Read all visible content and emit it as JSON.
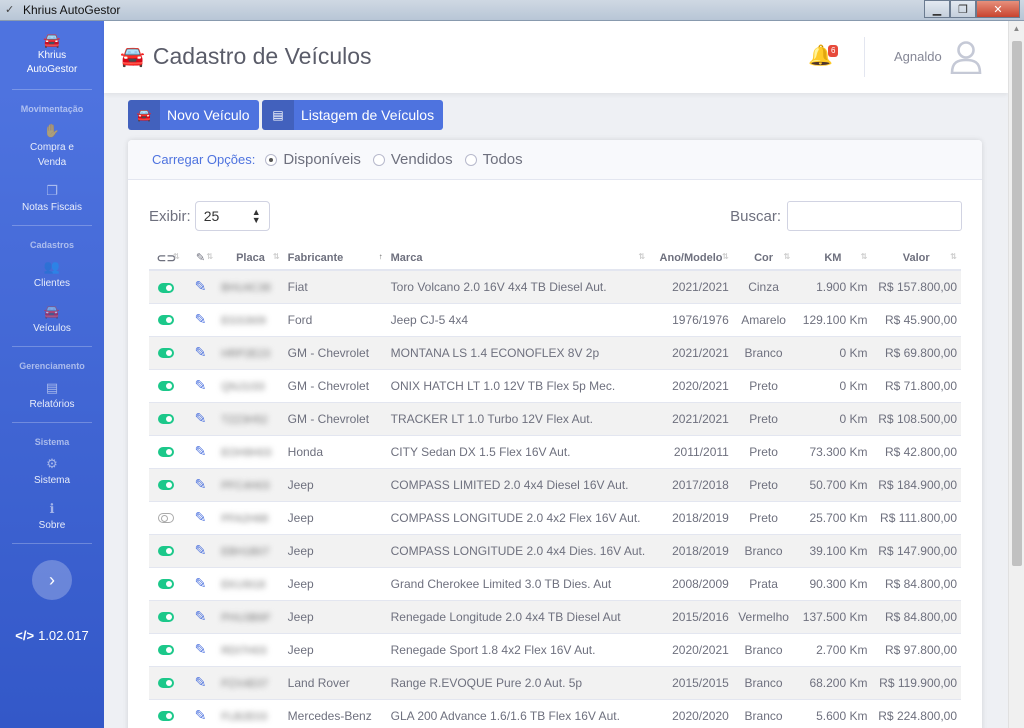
{
  "window": {
    "title": "Khrius AutoGestor"
  },
  "sidebar": {
    "brand_line1": "Khrius",
    "brand_line2": "AutoGestor",
    "sections": [
      {
        "heading": "Movimentação",
        "items": [
          {
            "label_line1": "Compra e",
            "label_line2": "Venda",
            "icon": "hand-holding-icon"
          },
          {
            "label_line1": "Notas Fiscais",
            "label_line2": "",
            "icon": "copy-icon"
          }
        ]
      },
      {
        "heading": "Cadastros",
        "items": [
          {
            "label_line1": "Clientes",
            "label_line2": "",
            "icon": "users-icon"
          },
          {
            "label_line1": "Veículos",
            "label_line2": "",
            "icon": "car-icon"
          }
        ]
      },
      {
        "heading": "Gerenciamento",
        "items": [
          {
            "label_line1": "Relatórios",
            "label_line2": "",
            "icon": "file-icon"
          }
        ]
      },
      {
        "heading": "Sistema",
        "items": [
          {
            "label_line1": "Sistema",
            "label_line2": "",
            "icon": "gear-icon"
          },
          {
            "label_line1": "Sobre",
            "label_line2": "",
            "icon": "info-icon"
          }
        ]
      }
    ],
    "version": "1.02.017"
  },
  "topbar": {
    "title": "Cadastro de Veículos",
    "notifications": "6",
    "user": "Agnaldo"
  },
  "actions": {
    "new_vehicle": "Novo Veículo",
    "vehicle_list": "Listagem de Veículos"
  },
  "filter": {
    "label": "Carregar Opções:",
    "options": [
      "Disponíveis",
      "Vendidos",
      "Todos"
    ],
    "selected": "Disponíveis"
  },
  "table_controls": {
    "show_label": "Exibir:",
    "page_size": "25",
    "search_label": "Buscar:",
    "search_value": ""
  },
  "table": {
    "headers": [
      "Placa",
      "Fabricante",
      "Marca",
      "Ano/Modelo",
      "Cor",
      "KM",
      "Valor"
    ],
    "rows": [
      {
        "active": true,
        "placa": "BHU4C38",
        "fabricante": "Fiat",
        "marca": "Toro Volcano 2.0 16V 4x4 TB Diesel Aut.",
        "ano": "2021/2021",
        "cor": "Cinza",
        "km": "1.900 Km",
        "valor": "R$ 157.800,00"
      },
      {
        "active": true,
        "placa": "EGS3I09",
        "fabricante": "Ford",
        "marca": "Jeep CJ-5 4x4",
        "ano": "1976/1976",
        "cor": "Amarelo",
        "km": "129.100 Km",
        "valor": "R$ 45.900,00"
      },
      {
        "active": true,
        "placa": "HRP2E23",
        "fabricante": "GM - Chevrolet",
        "marca": "MONTANA LS 1.4 ECONOFLEX 8V 2p",
        "ano": "2021/2021",
        "cor": "Branco",
        "km": "0 Km",
        "valor": "R$ 69.800,00"
      },
      {
        "active": true,
        "placa": "QNJ1I33",
        "fabricante": "GM - Chevrolet",
        "marca": "ONIX HATCH LT 1.0 12V TB Flex 5p Mec.",
        "ano": "2020/2021",
        "cor": "Preto",
        "km": "0 Km",
        "valor": "R$ 71.800,00"
      },
      {
        "active": true,
        "placa": "TZZ3H52",
        "fabricante": "GM - Chevrolet",
        "marca": "TRACKER LT 1.0 Turbo 12V Flex Aut.",
        "ano": "2021/2021",
        "cor": "Preto",
        "km": "0 Km",
        "valor": "R$ 108.500,00"
      },
      {
        "active": true,
        "placa": "EOH9H03",
        "fabricante": "Honda",
        "marca": "CITY Sedan DX 1.5 Flex 16V Aut.",
        "ano": "2011/2011",
        "cor": "Preto",
        "km": "73.300 Km",
        "valor": "R$ 42.800,00"
      },
      {
        "active": true,
        "placa": "PFC4H03",
        "fabricante": "Jeep",
        "marca": "COMPASS LIMITED 2.0 4x4 Diesel 16V Aut.",
        "ano": "2017/2018",
        "cor": "Preto",
        "km": "50.700 Km",
        "valor": "R$ 184.900,00"
      },
      {
        "active": false,
        "placa": "PFA2H68",
        "fabricante": "Jeep",
        "marca": "COMPASS LONGITUDE 2.0 4x2 Flex 16V Aut.",
        "ano": "2018/2019",
        "cor": "Preto",
        "km": "25.700 Km",
        "valor": "R$ 111.800,00"
      },
      {
        "active": true,
        "placa": "EBH1B07",
        "fabricante": "Jeep",
        "marca": "COMPASS LONGITUDE 2.0 4x4 Dies. 16V Aut.",
        "ano": "2018/2019",
        "cor": "Branco",
        "km": "39.100 Km",
        "valor": "R$ 147.900,00"
      },
      {
        "active": true,
        "placa": "EKU9I18",
        "fabricante": "Jeep",
        "marca": "Grand Cherokee Limited 3.0 TB Dies. Aut",
        "ano": "2008/2009",
        "cor": "Prata",
        "km": "90.300 Km",
        "valor": "R$ 84.800,00"
      },
      {
        "active": true,
        "placa": "PHU3B6F",
        "fabricante": "Jeep",
        "marca": "Renegade Longitude 2.0 4x4 TB Diesel Aut",
        "ano": "2015/2016",
        "cor": "Vermelho",
        "km": "137.500 Km",
        "valor": "R$ 84.800,00"
      },
      {
        "active": true,
        "placa": "RDI7H03",
        "fabricante": "Jeep",
        "marca": "Renegade Sport 1.8 4x2 Flex 16V Aut.",
        "ano": "2020/2021",
        "cor": "Branco",
        "km": "2.700 Km",
        "valor": "R$ 97.800,00"
      },
      {
        "active": true,
        "placa": "PZX4E07",
        "fabricante": "Land Rover",
        "marca": "Range R.EVOQUE Pure 2.0 Aut. 5p",
        "ano": "2015/2015",
        "cor": "Branco",
        "km": "68.200 Km",
        "valor": "R$ 119.900,00"
      },
      {
        "active": true,
        "placa": "FLB2E03",
        "fabricante": "Mercedes-Benz",
        "marca": "GLA 200 Advance 1.6/1.6 TB Flex 16V Aut.",
        "ano": "2020/2020",
        "cor": "Branco",
        "km": "5.600 Km",
        "valor": "R$ 224.800,00"
      }
    ]
  }
}
